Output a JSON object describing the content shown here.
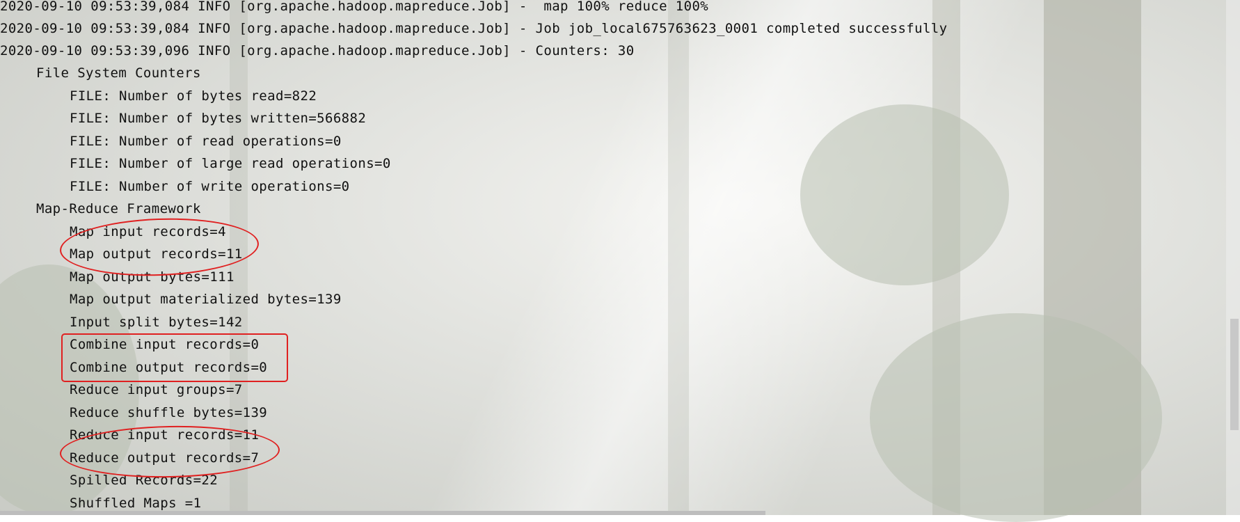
{
  "log_lines": [
    "2020-09-10 09:53:39,084 INFO [org.apache.hadoop.mapreduce.Job] -  map 100% reduce 100%",
    "2020-09-10 09:53:39,084 INFO [org.apache.hadoop.mapreduce.Job] - Job job_local675763623_0001 completed successfully",
    "2020-09-10 09:53:39,096 INFO [org.apache.hadoop.mapreduce.Job] - Counters: 30"
  ],
  "counter_groups": [
    {
      "name": "File System Counters",
      "counters": [
        "FILE: Number of bytes read=822",
        "FILE: Number of bytes written=566882",
        "FILE: Number of read operations=0",
        "FILE: Number of large read operations=0",
        "FILE: Number of write operations=0"
      ]
    },
    {
      "name": "Map-Reduce Framework",
      "counters": [
        "Map input records=4",
        "Map output records=11",
        "Map output bytes=111",
        "Map output materialized bytes=139",
        "Input split bytes=142",
        "Combine input records=0",
        "Combine output records=0",
        "Reduce input groups=7",
        "Reduce shuffle bytes=139",
        "Reduce input records=11",
        "Reduce output records=7",
        "Spilled Records=22",
        "Shuffled Maps =1"
      ]
    }
  ],
  "annotation_color": "#e02020"
}
